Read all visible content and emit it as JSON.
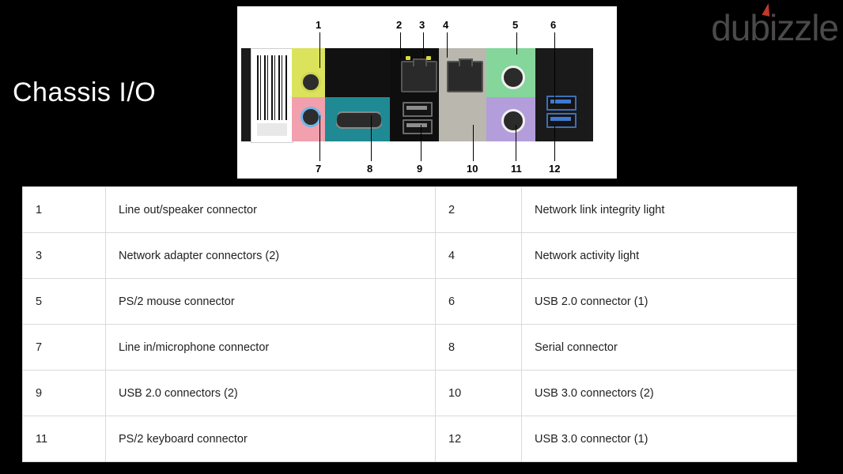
{
  "watermark": {
    "text": "dubizzle"
  },
  "title": "Chassis I/O",
  "diagram": {
    "alt": "Rear chassis I/O panel photograph",
    "callouts": [
      "1",
      "2",
      "3",
      "4",
      "5",
      "6",
      "7",
      "8",
      "9",
      "10",
      "11",
      "12"
    ]
  },
  "table": {
    "rows": [
      {
        "n1": "1",
        "d1": "Line out/speaker connector",
        "n2": "2",
        "d2": "Network link integrity light"
      },
      {
        "n1": "3",
        "d1": "Network adapter connectors (2)",
        "n2": "4",
        "d2": "Network activity light"
      },
      {
        "n1": "5",
        "d1": "PS/2 mouse connector",
        "n2": "6",
        "d2": "USB 2.0 connector (1)"
      },
      {
        "n1": "7",
        "d1": "Line in/microphone connector",
        "n2": "8",
        "d2": "Serial connector"
      },
      {
        "n1": "9",
        "d1": "USB 2.0 connectors (2)",
        "n2": "10",
        "d2": "USB 3.0 connectors (2)"
      },
      {
        "n1": "11",
        "d1": "PS/2 keyboard connector",
        "n2": "12",
        "d2": "USB 3.0 connector (1)"
      }
    ]
  },
  "colors": {
    "background": "#000000",
    "panel": "#ffffff",
    "title": "#ffffff",
    "watermark": "#4a4a4a",
    "line_out_green": "#dbe35c",
    "line_in_pink": "#f2a0ae",
    "serial_teal": "#1f8a93",
    "ps2_mouse_green": "#84d69a",
    "ps2_keyboard_purple": "#b39ddb",
    "usb3_blue": "#3f7ad0"
  }
}
